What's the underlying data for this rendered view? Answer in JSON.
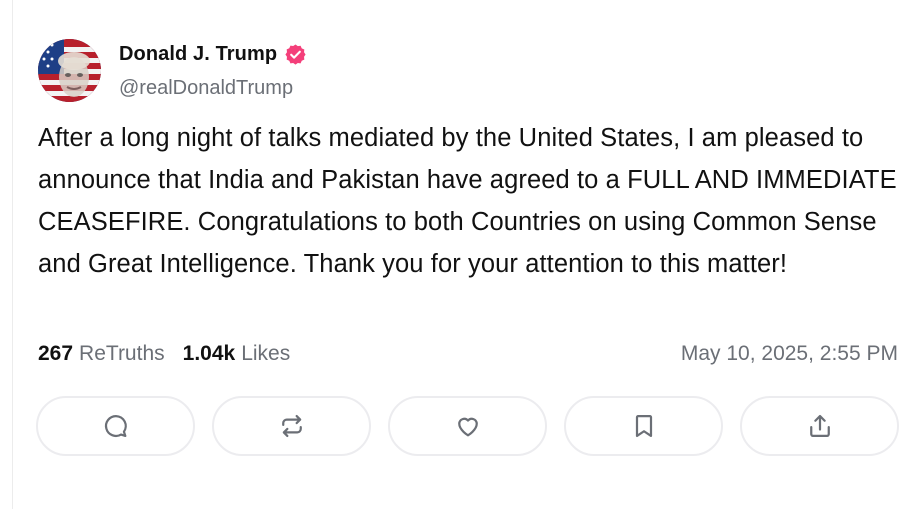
{
  "author": {
    "display_name": "Donald J. Trump",
    "handle": "@realDonaldTrump",
    "verified_color": "#f43f7a"
  },
  "post": {
    "text": "After a long night of talks mediated by the United States, I am pleased to announce that India and Pakistan have agreed to a FULL AND IMMEDIATE CEASEFIRE. Congratulations to both Countries on using Common Sense and Great Intelligence. Thank you for your attention to this matter!",
    "retruths_count": "267",
    "retruths_label": "ReTruths",
    "likes_count": "1.04k",
    "likes_label": "Likes",
    "timestamp": "May 10, 2025, 2:55 PM"
  },
  "actions": [
    {
      "icon": "reply-icon"
    },
    {
      "icon": "retruth-icon"
    },
    {
      "icon": "like-icon"
    },
    {
      "icon": "bookmark-icon"
    },
    {
      "icon": "share-icon"
    }
  ],
  "colors": {
    "text": "#111111",
    "muted": "#6b6f76",
    "border": "#ececef",
    "accent": "#f43f7a"
  }
}
